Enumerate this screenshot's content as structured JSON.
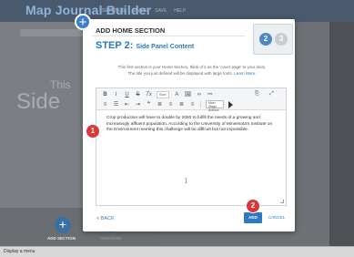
{
  "app": {
    "title": "Map Journal Builder",
    "menu": [
      "SETTINGS",
      "SHARE",
      "SAVE",
      "HELP"
    ]
  },
  "background": {
    "panel_title_line1": "This",
    "panel_title_line2": "Side",
    "add_section_label": "ADD SECTION",
    "organize_label": "ORGANIZE"
  },
  "status_bar": {
    "text": "Display a menu"
  },
  "modal": {
    "title": "ADD HOME SECTION",
    "step_prefix": "STEP 2:",
    "step_subtitle": "Side Panel Content",
    "step_indicator": {
      "active": "2",
      "next": "3"
    },
    "intro_line1": "This first section is your Home Section, think of it as the 'cover page' to your story.",
    "intro_line2": "The title you just defined will be displayed with large fonts.",
    "learn_more": "Learn More.",
    "toolbar": {
      "bold": "B",
      "italic": "I",
      "underline": "U",
      "strike": "S",
      "clear_format": "Tx",
      "size_label": "Size",
      "font_color": "A",
      "media": "🖼",
      "link": "∞",
      "unlink": "⚯",
      "source": "⎘",
      "maximize": "⤢",
      "list_numbered": "≡",
      "list_bullet": "☰",
      "indent_out": "⇤",
      "indent_in": "⇥",
      "quote": "❞",
      "align_left": "≣",
      "align_center": "≡",
      "align_right": "≣",
      "align_justify": "≡",
      "story_action_label": "Main Stage Actions"
    },
    "editor_text": "Crop production will have to double by 2050 to fulfill the needs of a growing and increasingly affluent population. According to the University of Minnesota's Institute on the Environment meeting this challenge will be difficult but not impossible.",
    "cursor_glyph": "I",
    "back_label": "< BACK",
    "add_label": "ADD",
    "cancel_label": "CANCEL"
  },
  "callouts": [
    "1",
    "2"
  ],
  "colors": {
    "accent": "#2c79b8",
    "callout": "#d9383b",
    "add_button": "#2c79c4"
  }
}
